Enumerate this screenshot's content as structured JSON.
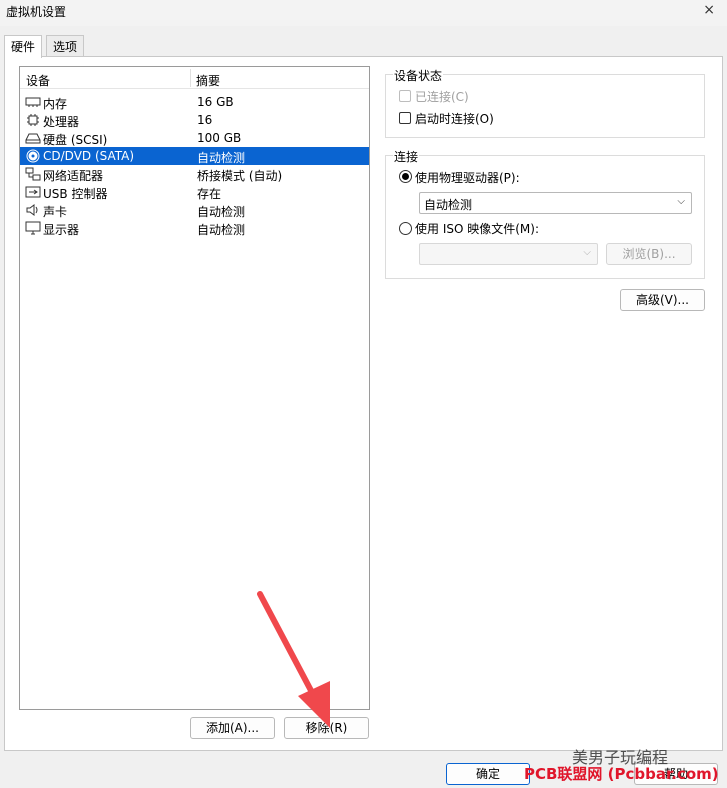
{
  "window": {
    "title": "虚拟机设置",
    "close": "×"
  },
  "tabs": [
    {
      "label": "硬件"
    },
    {
      "label": "选项"
    }
  ],
  "device_list": {
    "col_device": "设备",
    "col_summary": "摘要",
    "rows": [
      {
        "icon": "memory-icon",
        "name": "内存",
        "summary": "16 GB"
      },
      {
        "icon": "cpu-icon",
        "name": "处理器",
        "summary": "16"
      },
      {
        "icon": "disk-icon",
        "name": "硬盘 (SCSI)",
        "summary": "100 GB"
      },
      {
        "icon": "cd-icon",
        "name": "CD/DVD (SATA)",
        "summary": "自动检测"
      },
      {
        "icon": "network-icon",
        "name": "网络适配器",
        "summary": "桥接模式 (自动)"
      },
      {
        "icon": "usb-icon",
        "name": "USB 控制器",
        "summary": "存在"
      },
      {
        "icon": "speaker-icon",
        "name": "声卡",
        "summary": "自动检测"
      },
      {
        "icon": "monitor-icon",
        "name": "显示器",
        "summary": "自动检测"
      }
    ],
    "selected_index": 3
  },
  "list_buttons": {
    "add": "添加(A)...",
    "remove": "移除(R)"
  },
  "device_status": {
    "title": "设备状态",
    "connected": "已连接(C)",
    "connect_on_power": "启动时连接(O)"
  },
  "connection": {
    "title": "连接",
    "use_physical": "使用物理驱动器(P):",
    "physical_value": "自动检测",
    "use_iso": "使用 ISO 映像文件(M):",
    "iso_value": "",
    "browse": "浏览(B)..."
  },
  "advanced_button": "高级(V)...",
  "footer": {
    "ok": "确定",
    "help": "帮助"
  },
  "watermarks": {
    "wechat": "美男子玩编程",
    "site": "PCB联盟网 (Pcbbar.com)"
  },
  "colors": {
    "selection": "#0a64d1",
    "annotation_arrow": "#f0484c",
    "watermark_red": "#e0162b"
  }
}
